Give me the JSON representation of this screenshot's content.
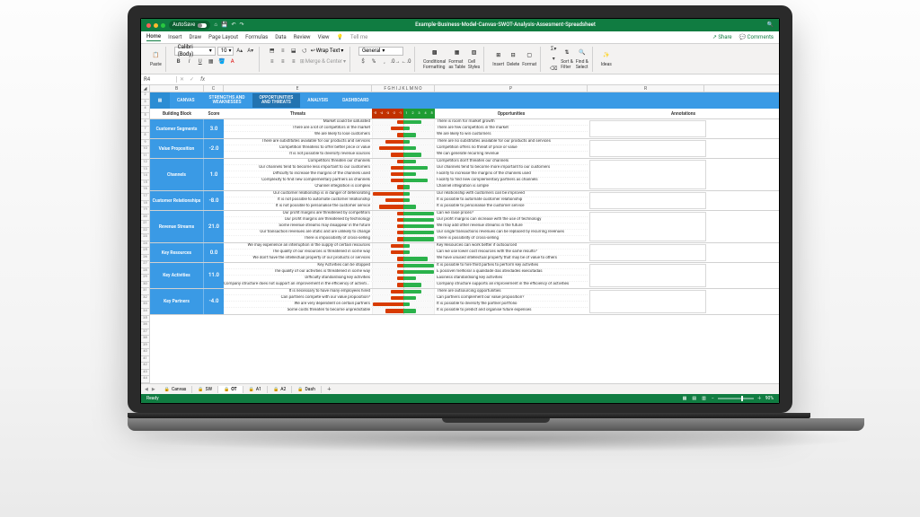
{
  "titlebar": {
    "autosave": "AutoSave",
    "title": "Example-Business-Model-Canvas-SWOT-Analysis-Assesment-Spreadsheet"
  },
  "ribbon_tabs": [
    "Home",
    "Insert",
    "Draw",
    "Page Layout",
    "Formulas",
    "Data",
    "Review",
    "View"
  ],
  "ribbon_tabs_active": 0,
  "tell_me": "Tell me",
  "share": "Share",
  "comments": "Comments",
  "font": {
    "name": "Calibri (Body)",
    "size": "10"
  },
  "wrap_text": "Wrap Text",
  "merge_center": "Merge & Center",
  "number_format": "General",
  "cond_fmt": "Conditional\nFormatting",
  "fmt_table": "Format\nas Table",
  "cell_styles": "Cell\nStyles",
  "insert": "Insert",
  "delete": "Delete",
  "format": "Format",
  "sort_filter": "Sort &\nFilter",
  "find_select": "Find &\nSelect",
  "ideas": "Ideas",
  "paste": "Paste",
  "namebox": "R4",
  "formula": "",
  "col_letters": [
    "A",
    "B",
    "C",
    "E",
    "F G H I J K L M N O",
    "P",
    "R"
  ],
  "nav_tabs": [
    "CANVAS",
    "STRENGTHS AND\nWEAKNESSES",
    "OPPORTUNITIES\nAND THREATS",
    "ANALYSIS",
    "DASHBOARD"
  ],
  "nav_active": 2,
  "headers": {
    "building_block": "Building Block",
    "score": "Score",
    "threats": "Threats",
    "opportunities": "Opportunities",
    "annotations": "Annotations"
  },
  "scale_neg": [
    "-5",
    "-4",
    "-3",
    "-2",
    "-1"
  ],
  "scale_pos": [
    "1",
    "2",
    "3",
    "4",
    "5"
  ],
  "blocks": [
    {
      "name": "Customer Segments",
      "score": "3.0",
      "lines": [
        {
          "t": "Market could be saturated",
          "tv": 1,
          "o": "There is room for market growth",
          "ov": 3
        },
        {
          "t": "There are a lot of competitors in the market",
          "tv": 2,
          "o": "There are few competitors in the market",
          "ov": 1
        },
        {
          "t": "We are likely to lose customers",
          "tv": 1,
          "o": "We are likely to win customers",
          "ov": 2
        }
      ]
    },
    {
      "name": "Value Proposition",
      "score": "-2.0",
      "lines": [
        {
          "t": "There are substitutes available for our products and services",
          "tv": 3,
          "o": "There are no substitutes available for our products and services",
          "ov": 1
        },
        {
          "t": "Competition threatens to offer better price or value",
          "tv": 4,
          "o": "Competition offers no threat of price or value",
          "ov": 2
        },
        {
          "t": "It is not possible to diversify revenue sources",
          "tv": 2,
          "o": "We can generate recurring revenue",
          "ov": 3
        }
      ]
    },
    {
      "name": "Channels",
      "score": "1.0",
      "lines": [
        {
          "t": "Competitors threaten our channels",
          "tv": 1,
          "o": "Competitors don't threaten our channels",
          "ov": 2
        },
        {
          "t": "Our channels tend to become less important to our customers",
          "tv": 2,
          "o": "Our channels tend to become more important to our customers",
          "ov": 4
        },
        {
          "t": "Difficulty to increase the margins of the channels used",
          "tv": 2,
          "o": "Facility to increase the margins of the channels used",
          "ov": 2
        },
        {
          "t": "Complexity to find new complementary partners as channels",
          "tv": 2,
          "o": "Facility to find new complementary partners as channels",
          "ov": 4
        },
        {
          "t": "Channel integration is complex",
          "tv": 1,
          "o": "Channel integration is simple",
          "ov": 1
        }
      ]
    },
    {
      "name": "Customer Relationships",
      "score": "-8.0",
      "lines": [
        {
          "t": "Our customer relationship is in danger of deteriorating",
          "tv": 5,
          "o": "Our relationship with customers can be improved",
          "ov": 1
        },
        {
          "t": "It is not possible to automate customer relationship",
          "tv": 3,
          "o": "It is possible to automate customer relationship",
          "ov": 1
        },
        {
          "t": "It is not possible to personalise the customer service",
          "tv": 4,
          "o": "It is possible to personalise the customer service",
          "ov": 2
        }
      ]
    },
    {
      "name": "Revenue Streams",
      "score": "21.0",
      "lines": [
        {
          "t": "Our profit margins are threatened by competitors",
          "tv": 1,
          "o": "Can we raise prices?",
          "ov": 5
        },
        {
          "t": "Our profit margins are threatened by technology",
          "tv": 1,
          "o": "Our profit margins can increase with the use of technology",
          "ov": 5
        },
        {
          "t": "Some revenue streams may disappear in the future",
          "tv": 1,
          "o": "We may add other revenue streams in the future",
          "ov": 5
        },
        {
          "t": "Our transaction revenues are static and are unlikely to change",
          "tv": 1,
          "o": "Our single transactions revenues can be replaced by recurring revenues",
          "ov": 5
        },
        {
          "t": "There is impossibility of cross-selling",
          "tv": 1,
          "o": "There is possibility of cross-selling",
          "ov": 5
        }
      ]
    },
    {
      "name": "Key Resources",
      "score": "0.0",
      "lines": [
        {
          "t": "We may experience an interruption in the supply of certain resources",
          "tv": 2,
          "o": "Key Resources can work better if outsourced",
          "ov": 1
        },
        {
          "t": "The quality of our resources is threatened in some way",
          "tv": 2,
          "o": "Can we use lower cost resources with the same results?",
          "ov": 1
        },
        {
          "t": "We don't have the intellectual property of our products or services",
          "tv": 1,
          "o": "We have unused intellectual property that may be of value to others",
          "ov": 4
        }
      ]
    },
    {
      "name": "Key Activities",
      "score": "11.0",
      "lines": [
        {
          "t": "Key Activities can be stopped",
          "tv": 1,
          "o": "It is possible to hire third parties to perform key activities",
          "ov": 5
        },
        {
          "t": "The quality of our activities is threatened in some way",
          "tv": 1,
          "o": "É possível melhorar a qualidade das atividades executadas",
          "ov": 5
        },
        {
          "t": "Difficulty standardising key activities",
          "tv": 1,
          "o": "Easiness standardising key activities",
          "ov": 2
        },
        {
          "t": "Company structure does not support an improvement in the efficiency of activities",
          "tv": 1,
          "o": "Company structure supports an improvement in the efficiency of activities",
          "ov": 3
        }
      ]
    },
    {
      "name": "Key Partners",
      "score": "-4.0",
      "lines": [
        {
          "t": "It is necessary to have many employees hired",
          "tv": 2,
          "o": "There are outsourcing opportunities",
          "ov": 3
        },
        {
          "t": "Can partners compete with our value proposition?",
          "tv": 2,
          "o": "Can partners complement our value proposition?",
          "ov": 2
        },
        {
          "t": "We are very dependent on certain partners",
          "tv": 5,
          "o": "It is possible to diversify the partner portfolio",
          "ov": 1
        },
        {
          "t": "Some costs threaten to become unpredictable",
          "tv": 3,
          "o": "It is possible to predict and organise future expenses",
          "ov": 2
        }
      ]
    }
  ],
  "sheet_tabs": [
    {
      "label": "Canvas",
      "locked": true
    },
    {
      "label": "SW",
      "locked": true
    },
    {
      "label": "OT",
      "locked": true,
      "active": true
    },
    {
      "label": "A1",
      "locked": true
    },
    {
      "label": "A2",
      "locked": true
    },
    {
      "label": "Dash",
      "locked": true
    }
  ],
  "status": {
    "ready": "Ready",
    "zoom": "90%"
  }
}
